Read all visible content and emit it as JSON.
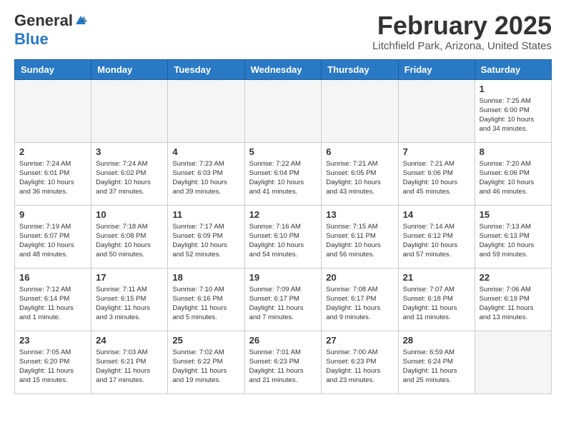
{
  "header": {
    "logo_general": "General",
    "logo_blue": "Blue",
    "month_title": "February 2025",
    "location": "Litchfield Park, Arizona, United States"
  },
  "days_of_week": [
    "Sunday",
    "Monday",
    "Tuesday",
    "Wednesday",
    "Thursday",
    "Friday",
    "Saturday"
  ],
  "weeks": [
    [
      {
        "day": "",
        "info": ""
      },
      {
        "day": "",
        "info": ""
      },
      {
        "day": "",
        "info": ""
      },
      {
        "day": "",
        "info": ""
      },
      {
        "day": "",
        "info": ""
      },
      {
        "day": "",
        "info": ""
      },
      {
        "day": "1",
        "info": "Sunrise: 7:25 AM\nSunset: 6:00 PM\nDaylight: 10 hours\nand 34 minutes."
      }
    ],
    [
      {
        "day": "2",
        "info": "Sunrise: 7:24 AM\nSunset: 6:01 PM\nDaylight: 10 hours\nand 36 minutes."
      },
      {
        "day": "3",
        "info": "Sunrise: 7:24 AM\nSunset: 6:02 PM\nDaylight: 10 hours\nand 37 minutes."
      },
      {
        "day": "4",
        "info": "Sunrise: 7:23 AM\nSunset: 6:03 PM\nDaylight: 10 hours\nand 39 minutes."
      },
      {
        "day": "5",
        "info": "Sunrise: 7:22 AM\nSunset: 6:04 PM\nDaylight: 10 hours\nand 41 minutes."
      },
      {
        "day": "6",
        "info": "Sunrise: 7:21 AM\nSunset: 6:05 PM\nDaylight: 10 hours\nand 43 minutes."
      },
      {
        "day": "7",
        "info": "Sunrise: 7:21 AM\nSunset: 6:06 PM\nDaylight: 10 hours\nand 45 minutes."
      },
      {
        "day": "8",
        "info": "Sunrise: 7:20 AM\nSunset: 6:06 PM\nDaylight: 10 hours\nand 46 minutes."
      }
    ],
    [
      {
        "day": "9",
        "info": "Sunrise: 7:19 AM\nSunset: 6:07 PM\nDaylight: 10 hours\nand 48 minutes."
      },
      {
        "day": "10",
        "info": "Sunrise: 7:18 AM\nSunset: 6:08 PM\nDaylight: 10 hours\nand 50 minutes."
      },
      {
        "day": "11",
        "info": "Sunrise: 7:17 AM\nSunset: 6:09 PM\nDaylight: 10 hours\nand 52 minutes."
      },
      {
        "day": "12",
        "info": "Sunrise: 7:16 AM\nSunset: 6:10 PM\nDaylight: 10 hours\nand 54 minutes."
      },
      {
        "day": "13",
        "info": "Sunrise: 7:15 AM\nSunset: 6:11 PM\nDaylight: 10 hours\nand 56 minutes."
      },
      {
        "day": "14",
        "info": "Sunrise: 7:14 AM\nSunset: 6:12 PM\nDaylight: 10 hours\nand 57 minutes."
      },
      {
        "day": "15",
        "info": "Sunrise: 7:13 AM\nSunset: 6:13 PM\nDaylight: 10 hours\nand 59 minutes."
      }
    ],
    [
      {
        "day": "16",
        "info": "Sunrise: 7:12 AM\nSunset: 6:14 PM\nDaylight: 11 hours\nand 1 minute."
      },
      {
        "day": "17",
        "info": "Sunrise: 7:11 AM\nSunset: 6:15 PM\nDaylight: 11 hours\nand 3 minutes."
      },
      {
        "day": "18",
        "info": "Sunrise: 7:10 AM\nSunset: 6:16 PM\nDaylight: 11 hours\nand 5 minutes."
      },
      {
        "day": "19",
        "info": "Sunrise: 7:09 AM\nSunset: 6:17 PM\nDaylight: 11 hours\nand 7 minutes."
      },
      {
        "day": "20",
        "info": "Sunrise: 7:08 AM\nSunset: 6:17 PM\nDaylight: 11 hours\nand 9 minutes."
      },
      {
        "day": "21",
        "info": "Sunrise: 7:07 AM\nSunset: 6:18 PM\nDaylight: 11 hours\nand 11 minutes."
      },
      {
        "day": "22",
        "info": "Sunrise: 7:06 AM\nSunset: 6:19 PM\nDaylight: 11 hours\nand 13 minutes."
      }
    ],
    [
      {
        "day": "23",
        "info": "Sunrise: 7:05 AM\nSunset: 6:20 PM\nDaylight: 11 hours\nand 15 minutes."
      },
      {
        "day": "24",
        "info": "Sunrise: 7:03 AM\nSunset: 6:21 PM\nDaylight: 11 hours\nand 17 minutes."
      },
      {
        "day": "25",
        "info": "Sunrise: 7:02 AM\nSunset: 6:22 PM\nDaylight: 11 hours\nand 19 minutes."
      },
      {
        "day": "26",
        "info": "Sunrise: 7:01 AM\nSunset: 6:23 PM\nDaylight: 11 hours\nand 21 minutes."
      },
      {
        "day": "27",
        "info": "Sunrise: 7:00 AM\nSunset: 6:23 PM\nDaylight: 11 hours\nand 23 minutes."
      },
      {
        "day": "28",
        "info": "Sunrise: 6:59 AM\nSunset: 6:24 PM\nDaylight: 11 hours\nand 25 minutes."
      },
      {
        "day": "",
        "info": ""
      }
    ]
  ]
}
